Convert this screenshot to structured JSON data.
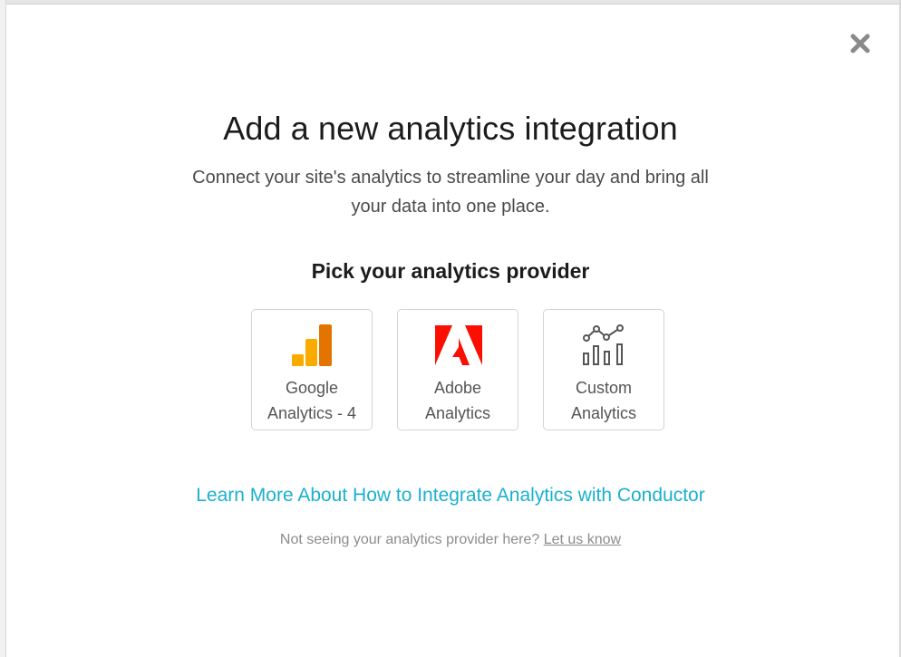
{
  "modal": {
    "title": "Add a new analytics integration",
    "subtitle": "Connect your site's analytics to streamline your day and bring all your data into one place.",
    "section_heading": "Pick your analytics provider",
    "close_icon": "close-icon"
  },
  "providers": [
    {
      "label_line1": "Google",
      "label_line2": "Analytics - 4",
      "icon": "google-analytics-icon"
    },
    {
      "label_line1": "Adobe",
      "label_line2": "Analytics",
      "icon": "adobe-icon"
    },
    {
      "label_line1": "Custom",
      "label_line2": "Analytics",
      "icon": "custom-analytics-chart-icon"
    }
  ],
  "learn_more": {
    "label": "Learn More About How to Integrate Analytics with Conductor"
  },
  "footnote": {
    "text": "Not seeing your analytics provider here?",
    "link_label": "Let us know"
  },
  "colors": {
    "link": "#1ab0d0",
    "google_orange": "#f9ab00",
    "google_dark_orange": "#e37400",
    "adobe_red": "#fa0f00",
    "text_dark": "#1c1c1c",
    "text_muted": "#8c8c8c"
  }
}
